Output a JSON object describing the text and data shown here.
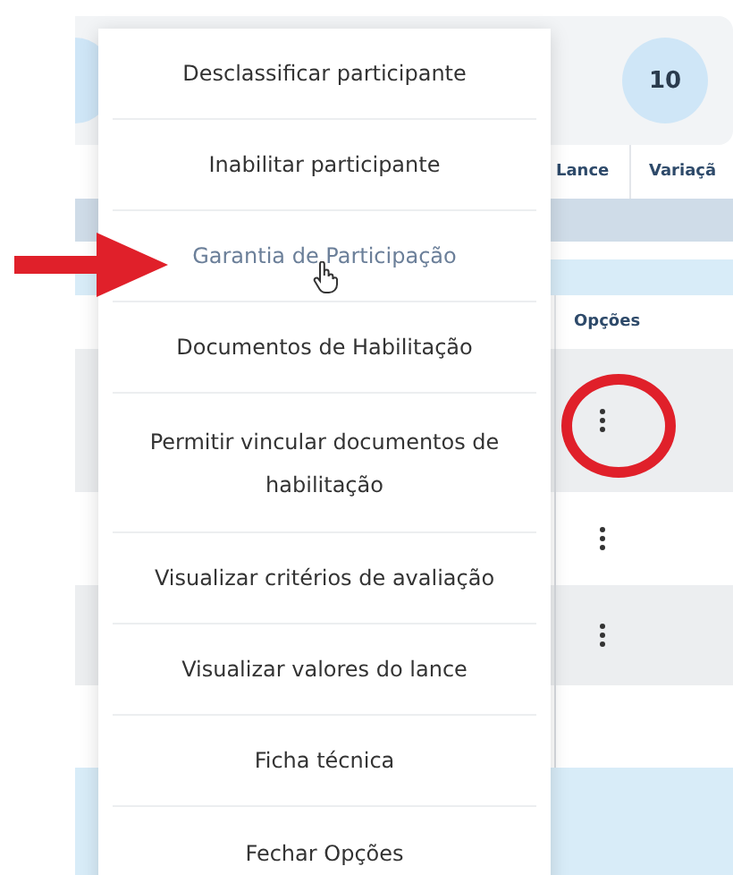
{
  "summary_card": {
    "badges": [
      {
        "label": "10"
      }
    ]
  },
  "table": {
    "columns": [
      "Lance",
      "Variaçã"
    ],
    "options_header": "Opções",
    "rows": [
      {
        "shaded": true,
        "has_options": true,
        "circled": true
      },
      {
        "shaded": false,
        "has_options": true,
        "circled": false
      },
      {
        "shaded": true,
        "has_options": true,
        "circled": false
      },
      {
        "shaded": false,
        "has_options": false,
        "circled": false
      }
    ]
  },
  "options_menu": {
    "items": [
      {
        "label": "Desclassificar participante",
        "selected": false
      },
      {
        "label": "Inabilitar participante",
        "selected": false
      },
      {
        "label": "Garantia de Participação",
        "selected": true
      },
      {
        "label": "Documentos de Habilitação",
        "selected": false
      },
      {
        "label": "Permitir vincular documentos de habilitação",
        "selected": false
      },
      {
        "label": "Visualizar critérios de avaliação",
        "selected": false
      },
      {
        "label": "Visualizar valores do lance",
        "selected": false
      },
      {
        "label": "Ficha técnica",
        "selected": false
      },
      {
        "label": "Fechar Opções",
        "selected": false
      }
    ]
  },
  "annotations": [
    {
      "kind": "arrow"
    }
  ]
}
